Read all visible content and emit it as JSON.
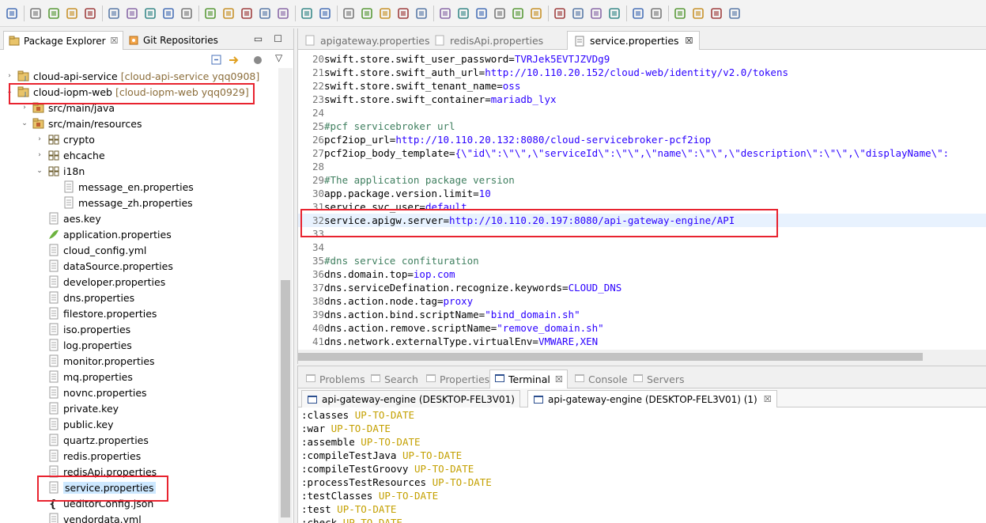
{
  "toolbar": {
    "icons": [
      "new-icon",
      "save-icon",
      "save-all-icon",
      "print-icon",
      "skip-breakpoints-icon",
      "resume-icon",
      "suspend-icon",
      "terminate-icon",
      "disconnect-icon",
      "step-into-icon",
      "step-over-icon",
      "step-return-icon",
      "drop-to-frame-icon",
      "use-step-filters-icon",
      "spring-icon",
      "toggle-mark-occurrences-icon",
      "browser-icon",
      "debug-icon",
      "run-icon",
      "coverage-icon",
      "stop-icon",
      "external-tools-icon",
      "new-java-project-icon",
      "new-package-icon",
      "new-class-icon",
      "open-type-icon",
      "open-task-icon",
      "search-icon",
      "open-folder-icon",
      "annotation-prev-icon",
      "annotation-next-icon",
      "pin-editor-icon",
      "globe-icon",
      "next-annotation-icon",
      "prev-annotation-icon",
      "last-edit-icon",
      "back-icon",
      "forward-icon"
    ]
  },
  "left_panel": {
    "tabs": [
      {
        "label": "Package Explorer",
        "close": "☒"
      },
      {
        "label": "Git Repositories"
      }
    ],
    "tree": [
      {
        "indent": 0,
        "arrow": "›",
        "label": "cloud-api-service",
        "decoration": "[cloud-api-service yqq0908]",
        "icon": "project-icon"
      },
      {
        "indent": 0,
        "arrow": "⌄",
        "label": "cloud-iopm-web",
        "decoration": "[cloud-iopm-web yqq0929]",
        "icon": "project-icon"
      },
      {
        "indent": 1,
        "arrow": "›",
        "label": "src/main/java",
        "icon": "source-folder-icon"
      },
      {
        "indent": 1,
        "arrow": "⌄",
        "label": "src/main/resources",
        "icon": "source-folder-icon"
      },
      {
        "indent": 2,
        "arrow": "›",
        "label": "crypto",
        "icon": "package-icon"
      },
      {
        "indent": 2,
        "arrow": "›",
        "label": "ehcache",
        "icon": "package-icon"
      },
      {
        "indent": 2,
        "arrow": "⌄",
        "label": "i18n",
        "icon": "package-icon"
      },
      {
        "indent": 3,
        "arrow": "",
        "label": "message_en.properties",
        "icon": "file-icon"
      },
      {
        "indent": 3,
        "arrow": "",
        "label": "message_zh.properties",
        "icon": "file-icon"
      },
      {
        "indent": 2,
        "arrow": "",
        "label": "aes.key",
        "icon": "file-icon"
      },
      {
        "indent": 2,
        "arrow": "",
        "label": "application.properties",
        "icon": "spring-file-icon"
      },
      {
        "indent": 2,
        "arrow": "",
        "label": "cloud_config.yml",
        "icon": "file-icon"
      },
      {
        "indent": 2,
        "arrow": "",
        "label": "dataSource.properties",
        "icon": "file-icon"
      },
      {
        "indent": 2,
        "arrow": "",
        "label": "developer.properties",
        "icon": "file-icon"
      },
      {
        "indent": 2,
        "arrow": "",
        "label": "dns.properties",
        "icon": "file-icon"
      },
      {
        "indent": 2,
        "arrow": "",
        "label": "filestore.properties",
        "icon": "file-icon"
      },
      {
        "indent": 2,
        "arrow": "",
        "label": "iso.properties",
        "icon": "file-icon"
      },
      {
        "indent": 2,
        "arrow": "",
        "label": "log.properties",
        "icon": "file-icon"
      },
      {
        "indent": 2,
        "arrow": "",
        "label": "monitor.properties",
        "icon": "file-icon"
      },
      {
        "indent": 2,
        "arrow": "",
        "label": "mq.properties",
        "icon": "file-icon"
      },
      {
        "indent": 2,
        "arrow": "",
        "label": "novnc.properties",
        "icon": "file-icon"
      },
      {
        "indent": 2,
        "arrow": "",
        "label": "private.key",
        "icon": "file-icon"
      },
      {
        "indent": 2,
        "arrow": "",
        "label": "public.key",
        "icon": "file-icon"
      },
      {
        "indent": 2,
        "arrow": "",
        "label": "quartz.properties",
        "icon": "file-icon"
      },
      {
        "indent": 2,
        "arrow": "",
        "label": "redis.properties",
        "icon": "file-icon"
      },
      {
        "indent": 2,
        "arrow": "",
        "label": "redisApi.properties",
        "icon": "file-icon"
      },
      {
        "indent": 2,
        "arrow": "",
        "label": "service.properties",
        "icon": "file-icon",
        "selected": true
      },
      {
        "indent": 2,
        "arrow": "",
        "label": "ueditorConfig.json",
        "icon": "json-icon"
      },
      {
        "indent": 2,
        "arrow": "",
        "label": "vendordata.yml",
        "icon": "file-icon"
      }
    ]
  },
  "editor": {
    "tabs": [
      {
        "label": "apigateway.properties",
        "active": false
      },
      {
        "label": "redisApi.properties",
        "active": false
      },
      {
        "label": "service.properties",
        "active": true,
        "close": "☒"
      }
    ],
    "lines": [
      {
        "n": "20",
        "key": "swift.store.swift_user_password=",
        "val": "TVRJek5EVTJZVDg9"
      },
      {
        "n": "21",
        "key": "swift.store.swift_auth_url=",
        "val": "http://10.110.20.152/cloud-web/identity/v2.0/tokens"
      },
      {
        "n": "22",
        "key": "swift.store.swift_tenant_name=",
        "val": "oss"
      },
      {
        "n": "23",
        "key": "swift.store.swift_container=",
        "val": "mariadb_lyx"
      },
      {
        "n": "24",
        "key": "",
        "val": ""
      },
      {
        "n": "25",
        "key": "",
        "val": "",
        "comment": "#pcf servicebroker url"
      },
      {
        "n": "26",
        "key": "pcf2iop_url=",
        "val": "http://10.110.20.132:8080/cloud-servicebroker-pcf2iop"
      },
      {
        "n": "27",
        "key": "pcf2iop_body_template=",
        "val": "{\\\"id\\\":\\\"\\\",\\\"serviceId\\\":\\\"\\\",\\\"name\\\":\\\"\\\",\\\"description\\\":\\\"\\\",\\\"displayName\\\":"
      },
      {
        "n": "28",
        "key": "",
        "val": ""
      },
      {
        "n": "29",
        "key": "",
        "val": "",
        "comment": "#The application package version"
      },
      {
        "n": "30",
        "key": "app.package.version.limit=",
        "val": "10"
      },
      {
        "n": "31",
        "key": "service.svc_user=",
        "val": "default"
      },
      {
        "n": "32",
        "key": "service.apigw.server=",
        "val": "http://10.110.20.197:8080/api-gateway-engine/API",
        "highlight": true
      },
      {
        "n": "33",
        "key": "",
        "val": ""
      },
      {
        "n": "34",
        "key": "",
        "val": ""
      },
      {
        "n": "35",
        "key": "",
        "val": "",
        "comment": "#dns service confituration"
      },
      {
        "n": "36",
        "key": "dns.domain.top=",
        "val": "iop.com"
      },
      {
        "n": "37",
        "key": "dns.serviceDefination.recognize.keywords=",
        "val": "CLOUD_DNS"
      },
      {
        "n": "38",
        "key": "dns.action.node.tag=",
        "val": "proxy"
      },
      {
        "n": "39",
        "key": "dns.action.bind.scriptName=",
        "val": "\"bind_domain.sh\""
      },
      {
        "n": "40",
        "key": "dns.action.remove.scriptName=",
        "val": "\"remove_domain.sh\""
      },
      {
        "n": "41",
        "key": "dns.network.externalType.virtualEnv=",
        "val": "VMWARE,XEN"
      }
    ]
  },
  "bottom_panel": {
    "tabs": [
      {
        "label": "Problems",
        "icon": "problems-icon"
      },
      {
        "label": "Search",
        "icon": "search-icon"
      },
      {
        "label": "Properties",
        "icon": "properties-icon"
      },
      {
        "label": "Terminal",
        "icon": "terminal-icon",
        "active": true,
        "close": "☒"
      },
      {
        "label": "Console",
        "icon": "console-icon"
      },
      {
        "label": "Servers",
        "icon": "servers-icon"
      }
    ],
    "terminal_tabs": [
      {
        "label": "api-gateway-engine (DESKTOP-FEL3V01)"
      },
      {
        "label": "api-gateway-engine (DESKTOP-FEL3V01) (1)",
        "close": "☒"
      }
    ],
    "terminal_lines": [
      {
        "task": ":classes",
        "status": "UP-TO-DATE"
      },
      {
        "task": ":war",
        "status": "UP-TO-DATE"
      },
      {
        "task": ":assemble",
        "status": "UP-TO-DATE"
      },
      {
        "task": ":compileTestJava",
        "status": "UP-TO-DATE"
      },
      {
        "task": ":compileTestGroovy",
        "status": "UP-TO-DATE"
      },
      {
        "task": ":processTestResources",
        "status": "UP-TO-DATE"
      },
      {
        "task": ":testClasses",
        "status": "UP-TO-DATE"
      },
      {
        "task": ":test",
        "status": "UP-TO-DATE"
      },
      {
        "task": ":check",
        "status": "UP-TO-DATE"
      }
    ]
  },
  "colors": {
    "callout_red": "#e8232f",
    "value_blue": "#2a00ff",
    "comment_green": "#3f7f5f",
    "status_yellow": "#c4a000",
    "selection": "#cde8ff"
  }
}
